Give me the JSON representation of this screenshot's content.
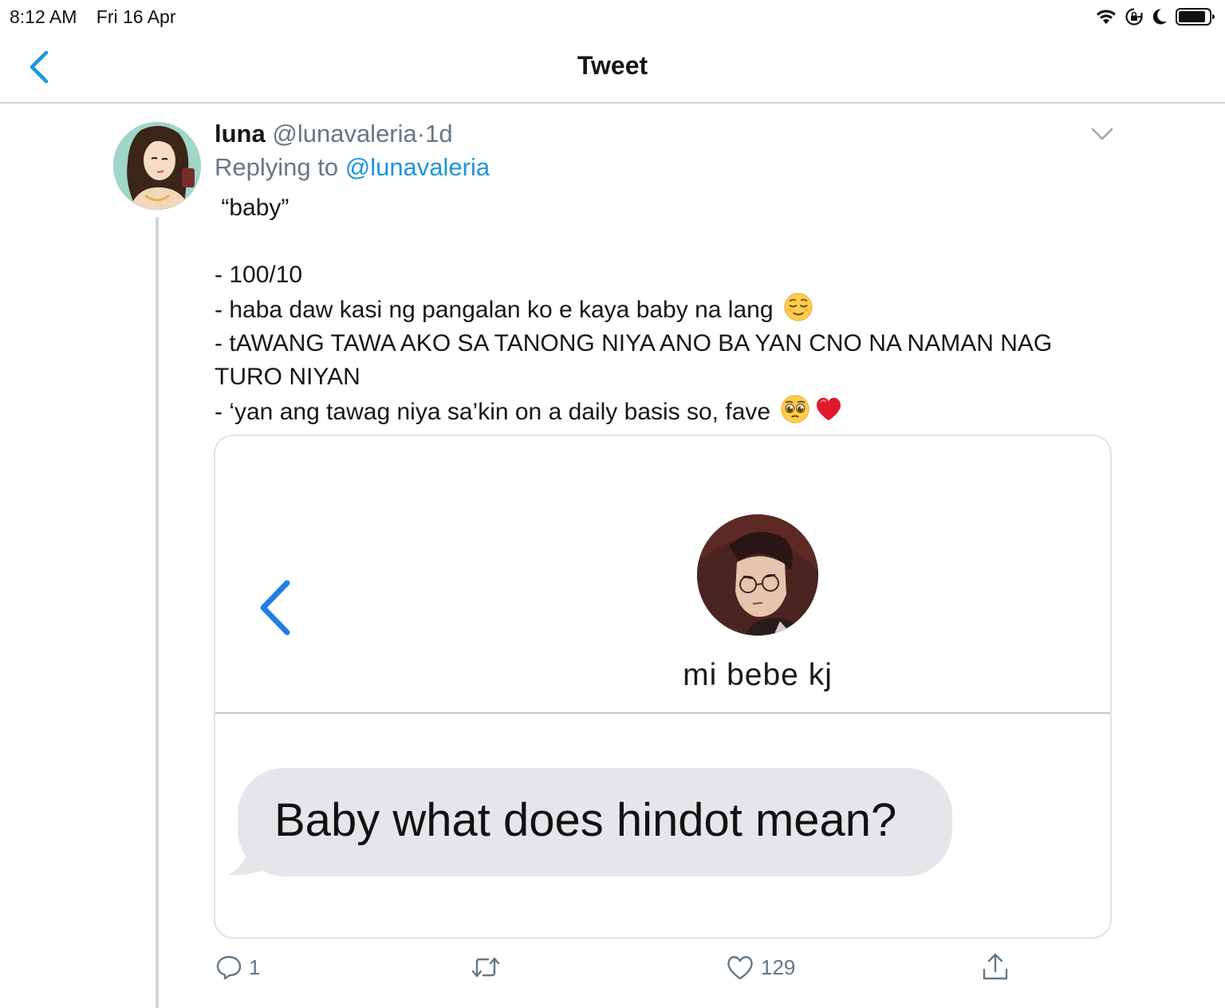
{
  "status_bar": {
    "time": "8:12 AM",
    "date": "Fri 16 Apr",
    "icons": [
      "wifi-icon",
      "rotation-lock-icon",
      "moon-icon",
      "battery-icon"
    ]
  },
  "nav": {
    "title": "Tweet",
    "back_icon": "chevron-left-icon"
  },
  "tweet": {
    "display_name": "luna",
    "handle": "@lunavaleria",
    "separator": "·",
    "time_ago": "1d",
    "replying_prefix": "Replying to",
    "replying_to": "@lunavaleria",
    "body_lines": [
      " “baby”",
      "",
      "- 100/10",
      "- haba daw kasi ng pangalan ko e kaya baby na lang",
      "- tAWANG TAWA AKO SA TANONG NIYA ANO BA YAN CNO NA NAMAN NAG TURO NIYAN",
      "- ‘yan ang tawag niya sa’kin on a daily basis so, fave"
    ],
    "emojis": [
      "relieved-face-emoji",
      "pleading-face-emoji",
      "red-heart-emoji"
    ]
  },
  "media": {
    "contact_name": "mi bebe kj",
    "message": "Baby what does hindot mean?"
  },
  "actions": {
    "reply_count": "1",
    "retweet_count": "",
    "like_count": "129"
  },
  "colors": {
    "link": "#1b95e0",
    "muted": "#657786",
    "divider": "#cfd6dc",
    "bubble": "#e6e6ea",
    "ios_blue": "#1f7ee8"
  }
}
